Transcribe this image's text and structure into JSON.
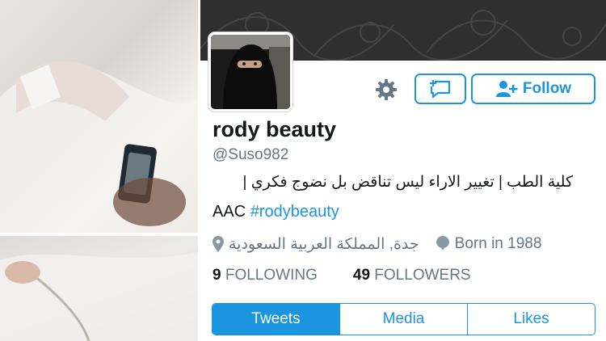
{
  "profile": {
    "display_name": "rody beauty",
    "handle": "@Suso982",
    "bio_line1": "كلية الطب | تغيير الاراء ليس تناقض بل نضوج فكري |",
    "bio_line2_prefix": "AAC ",
    "bio_hashtag": "#rodybeauty",
    "location": "جدة, المملكة العربية السعودية",
    "born": "Born in 1988"
  },
  "actions": {
    "follow_label": "Follow"
  },
  "stats": {
    "following_count": "9",
    "following_label": "FOLLOWING",
    "followers_count": "49",
    "followers_label": "FOLLOWERS"
  },
  "tabs": [
    {
      "label": "Tweets",
      "active": true
    },
    {
      "label": "Media",
      "active": false
    },
    {
      "label": "Likes",
      "active": false
    }
  ],
  "colors": {
    "accent": "#1b95e0",
    "banner": "#2f2f2f"
  }
}
